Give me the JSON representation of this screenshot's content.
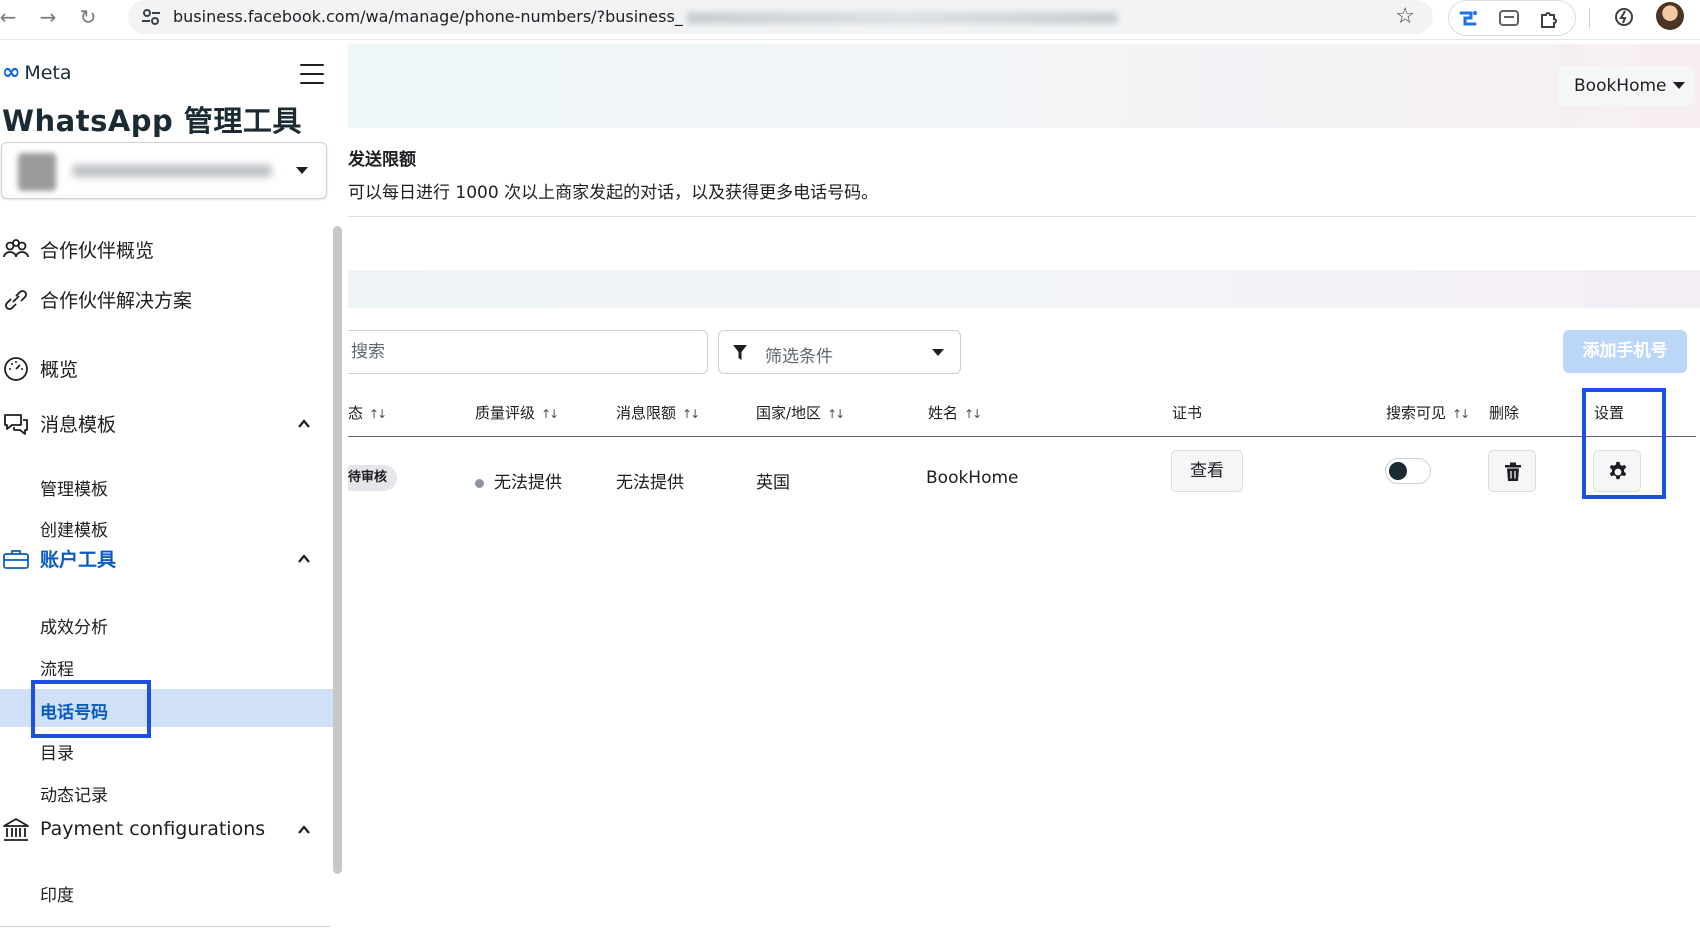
{
  "browser": {
    "url": "business.facebook.com/wa/manage/phone-numbers/?business_"
  },
  "sidebar": {
    "brand": "Meta",
    "app_title": "WhatsApp 管理工具",
    "items": [
      {
        "label": "合作伙伴概览"
      },
      {
        "label": "合作伙伴解决方案"
      },
      {
        "label": "概览"
      },
      {
        "label": "消息模板"
      },
      {
        "label": "账户工具"
      },
      {
        "label": "Payment configurations"
      }
    ],
    "templates_sub": [
      "管理模板",
      "创建模板"
    ],
    "account_tools_sub": [
      "成效分析",
      "流程",
      "电话号码",
      "目录",
      "动态记录"
    ],
    "payment_sub": [
      "印度"
    ],
    "active_item": "电话号码"
  },
  "header": {
    "account_name": "BookHome"
  },
  "limit": {
    "title": "发送限额",
    "description": "可以每日进行 1000 次以上商家发起的对话，以及获得更多电话号码。"
  },
  "toolbar": {
    "search_placeholder": "搜索",
    "filter_label": "筛选条件",
    "add_button": "添加手机号"
  },
  "table": {
    "columns": [
      "态",
      "质量评级",
      "消息限额",
      "国家/地区",
      "姓名",
      "证书",
      "搜索可见",
      "删除",
      "设置"
    ],
    "rows": [
      {
        "status": "待审核",
        "quality": "无法提供",
        "message_limit": "无法提供",
        "country": "英国",
        "name": "BookHome",
        "certificate_button": "查看",
        "search_visible": false
      }
    ]
  },
  "colors": {
    "accent": "#0a5bc4",
    "highlight_box": "#1f4fe0",
    "add_button_disabled": "#bcd6f7"
  }
}
